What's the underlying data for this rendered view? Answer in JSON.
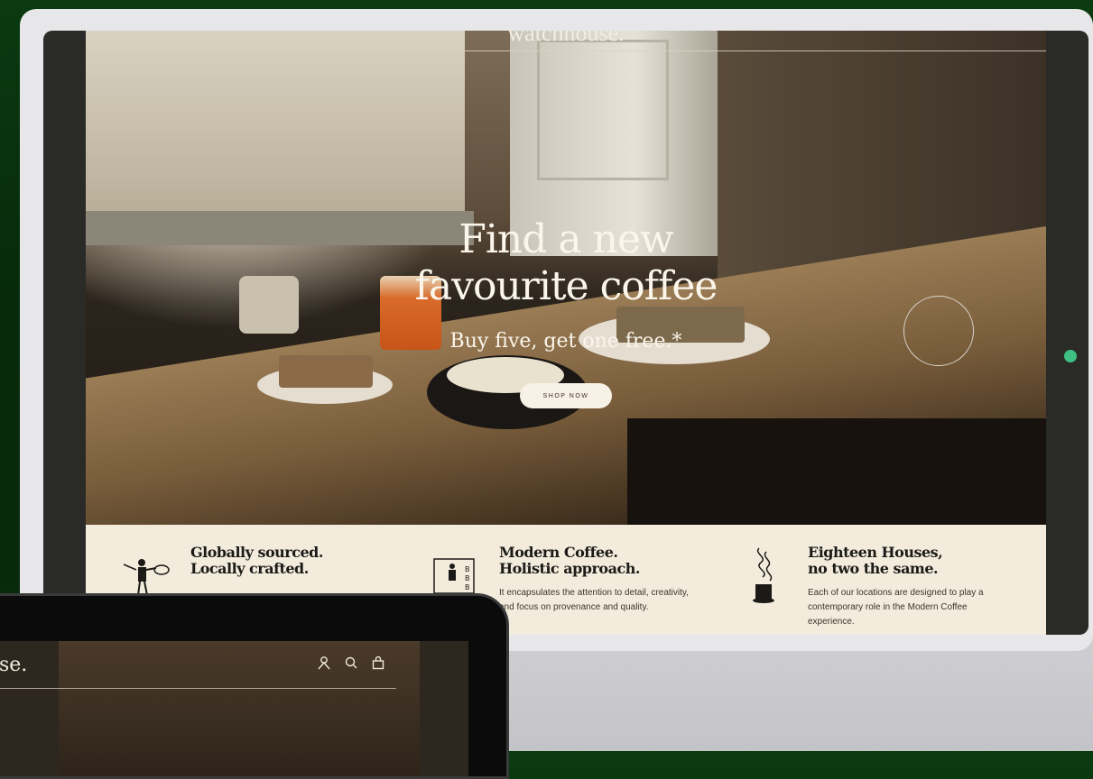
{
  "brand": "watchhouse.",
  "hero": {
    "headline_line1": "Find a new",
    "headline_line2": "favourite coffee",
    "subline": "Buy five, get one free.*",
    "cta": "SHOP NOW"
  },
  "features": [
    {
      "title_line1": "Globally sourced.",
      "title_line2": "Locally crafted.",
      "body": "",
      "icon": "barista-icon"
    },
    {
      "title_line1": "Modern Coffee.",
      "title_line2": "Holistic approach.",
      "body": "It encapsulates the attention to detail, creativity, and focus on provenance and quality.",
      "icon": "coffee-menu-icon"
    },
    {
      "title_line1": "Eighteen Houses,",
      "title_line2": "no two the same.",
      "body": "Each of our locations are designed to play a contemporary role in the Modern Coffee experience.",
      "icon": "steaming-cup-icon"
    }
  ],
  "laptop": {
    "brand_partial": "se.",
    "icons": [
      "account-icon",
      "search-icon",
      "bag-icon"
    ]
  },
  "colors": {
    "cream": "#f3ecdd",
    "accent_dot": "#3fbf82",
    "background_green": "#0b3a10"
  }
}
